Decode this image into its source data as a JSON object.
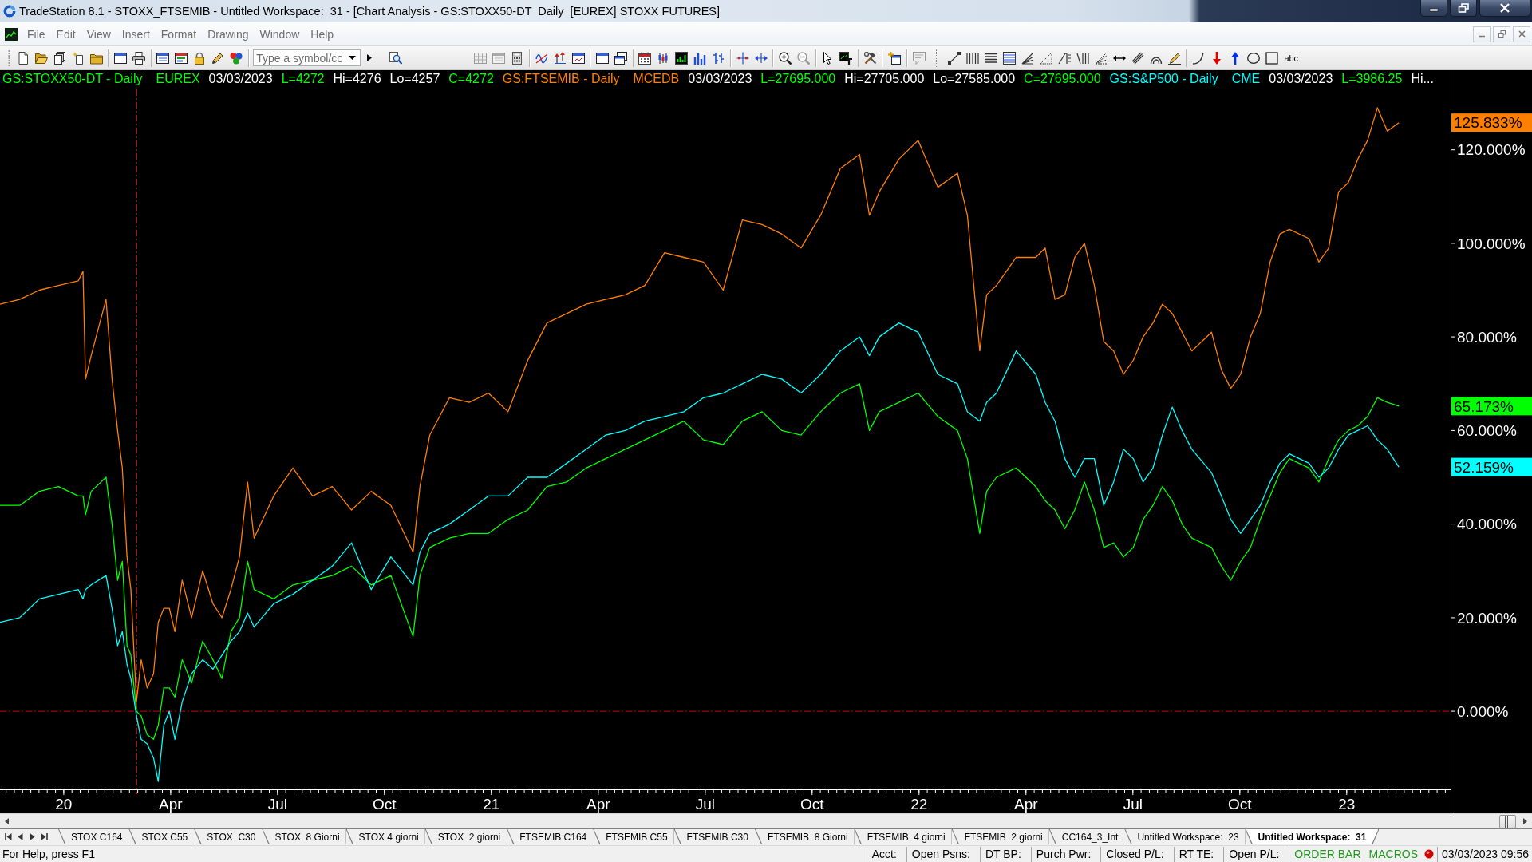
{
  "window": {
    "title": "TradeStation 8.1 - STOXX_FTSEMIB - Untitled Workspace:  31 - [Chart Analysis - GS:STOXX50-DT  Daily  [EUREX] STOXX FUTURES]"
  },
  "menu": [
    "File",
    "Edit",
    "View",
    "Insert",
    "Format",
    "Drawing",
    "Window",
    "Help"
  ],
  "toolbar": {
    "symbol_field": {
      "placeholder": "Type a symbol/co"
    },
    "text_tool": "abc"
  },
  "chart": {
    "legend": [
      {
        "symbol": "GS:STOXX50-DT - Daily",
        "exchange": "EUREX",
        "date": "03/03/2023",
        "last": "L=4272",
        "high": "Hi=4276",
        "low": "Lo=4257",
        "close": "C=4272",
        "color": "#00ff00"
      },
      {
        "symbol": "GS:FTSEMIB - Daily",
        "exchange": "MCEDB",
        "date": "03/03/2023",
        "last": "L=27695.000",
        "high": "Hi=27705.000",
        "low": "Lo=27585.000",
        "close": "C=27695.000",
        "color": "#ff8000"
      },
      {
        "symbol": "GS:S&P500 - Daily",
        "exchange": "CME",
        "date": "03/03/2023",
        "last": "L=3986.25",
        "high": "Hi...",
        "color": "#00ffff"
      }
    ],
    "last_value_labels": [
      "125.833%",
      "65.173%",
      "52.159%"
    ],
    "chart_data": {
      "type": "line",
      "x": [
        2019.851,
        2019.897,
        2019.943,
        2019.988,
        2020.034,
        2020.045,
        2020.051,
        2020.064,
        2020.099,
        2020.113,
        2020.126,
        2020.137,
        2020.148,
        2020.157,
        2020.17,
        2020.181,
        2020.195,
        2020.21,
        2020.221,
        2020.234,
        2020.247,
        2020.26,
        2020.277,
        2020.299,
        2020.325,
        2020.349,
        2020.37,
        2020.391,
        2020.411,
        2020.43,
        2020.445,
        2020.491,
        2020.536,
        2020.582,
        2020.628,
        2020.673,
        2020.719,
        2020.765,
        2020.817,
        2020.833,
        2020.856,
        2020.902,
        2020.948,
        2020.993,
        2021.039,
        2021.085,
        2021.13,
        2021.176,
        2021.222,
        2021.267,
        2021.313,
        2021.359,
        2021.405,
        2021.45,
        2021.496,
        2021.542,
        2021.587,
        2021.633,
        2021.679,
        2021.724,
        2021.77,
        2021.816,
        2021.861,
        2021.884,
        2021.907,
        2021.953,
        2021.998,
        2022.044,
        2022.09,
        2022.113,
        2022.142,
        2022.158,
        2022.181,
        2022.227,
        2022.273,
        2022.295,
        2022.318,
        2022.341,
        2022.364,
        2022.387,
        2022.41,
        2022.432,
        2022.455,
        2022.478,
        2022.501,
        2022.524,
        2022.547,
        2022.569,
        2022.592,
        2022.615,
        2022.638,
        2022.684,
        2022.707,
        2022.729,
        2022.752,
        2022.775,
        2022.798,
        2022.821,
        2022.844,
        2022.866,
        2022.912,
        2022.935,
        2022.958,
        2022.981,
        2023.004,
        2023.026,
        2023.049,
        2023.072,
        2023.095,
        2023.122
      ],
      "series": [
        {
          "color": "#ff8000",
          "values": [
            87,
            88,
            90,
            91,
            92,
            94,
            71,
            76,
            88,
            71,
            60,
            52,
            33,
            26,
            2,
            11,
            5,
            8,
            19,
            22,
            22,
            17,
            28,
            20,
            30,
            23,
            20,
            26,
            33,
            49,
            37,
            46,
            52,
            46,
            48,
            43,
            47,
            44,
            34,
            48,
            59,
            67,
            66,
            68,
            64,
            75,
            83,
            85,
            87,
            88,
            89,
            91,
            98,
            97,
            96,
            90,
            105,
            104,
            102,
            99,
            106,
            116,
            119,
            106,
            111,
            118,
            122,
            112,
            115,
            106,
            77,
            89,
            91,
            97,
            97,
            99,
            88,
            89,
            97,
            100,
            91,
            79,
            77,
            72,
            75,
            80,
            83,
            87,
            85,
            81,
            77,
            81,
            73,
            69,
            72,
            80,
            85,
            96,
            102,
            103,
            101,
            96,
            99,
            111,
            113,
            118,
            122,
            129,
            124,
            125.8
          ]
        },
        {
          "color": "#00ff00",
          "values": [
            44,
            44,
            47,
            48,
            46,
            46,
            42,
            47,
            50,
            40,
            28,
            32,
            14,
            12,
            0,
            -1,
            -5,
            -6,
            -3,
            5,
            5,
            3,
            11,
            6,
            15,
            11,
            7,
            17,
            20,
            32,
            26,
            24,
            27,
            28,
            29,
            31,
            27,
            29,
            16,
            29,
            35,
            37,
            38,
            38,
            41,
            43,
            48,
            49,
            52,
            54,
            56,
            58,
            60,
            62,
            58,
            57,
            62,
            64,
            60,
            59,
            64,
            68,
            70,
            60,
            64,
            66,
            68,
            63,
            60,
            54,
            38,
            47,
            50,
            52,
            48,
            45,
            43,
            39,
            43,
            49,
            43,
            35,
            36,
            33,
            35,
            41,
            44,
            48,
            45,
            40,
            37,
            35,
            31,
            28,
            32,
            35,
            41,
            46,
            51,
            54,
            52,
            49,
            54,
            58,
            60,
            61,
            63,
            67,
            66,
            65.2
          ]
        },
        {
          "color": "#00ffff",
          "values": [
            19,
            20,
            24,
            25,
            26,
            24,
            26,
            27,
            29,
            22,
            14,
            17,
            10,
            7,
            -1,
            -6,
            -7,
            -10,
            -15,
            -3,
            0,
            -6,
            2,
            8,
            11,
            9,
            12,
            15,
            17,
            21,
            18,
            23,
            25,
            28,
            31,
            36,
            26,
            33,
            27,
            34,
            38,
            40,
            43,
            46,
            46,
            50,
            50,
            53,
            56,
            59,
            60,
            62,
            63,
            64,
            67,
            68,
            70,
            72,
            71,
            68,
            72,
            77,
            80,
            76,
            80,
            83,
            81,
            72,
            70,
            64,
            62,
            66,
            68,
            77,
            72,
            66,
            62,
            54,
            50,
            54,
            54,
            44,
            49,
            56,
            54,
            49,
            52,
            59,
            65,
            60,
            56,
            51,
            46,
            41,
            38,
            41,
            44,
            49,
            53,
            55,
            53,
            50,
            52,
            56,
            59,
            60,
            61,
            58,
            56,
            52.2
          ]
        }
      ],
      "xlim": [
        2019.851,
        2023.243
      ],
      "ylim": [
        -16.7,
        137.0
      ],
      "xticks": [
        {
          "value": 2020,
          "label": "20"
        },
        {
          "value": 2020.25,
          "label": "Apr"
        },
        {
          "value": 2020.5,
          "label": "Jul"
        },
        {
          "value": 2020.75,
          "label": "Oct"
        },
        {
          "value": 2021,
          "label": "21"
        },
        {
          "value": 2021.25,
          "label": "Apr"
        },
        {
          "value": 2021.5,
          "label": "Jul"
        },
        {
          "value": 2021.75,
          "label": "Oct"
        },
        {
          "value": 2022,
          "label": "22"
        },
        {
          "value": 2022.25,
          "label": "Apr"
        },
        {
          "value": 2022.5,
          "label": "Jul"
        },
        {
          "value": 2022.75,
          "label": "Oct"
        },
        {
          "value": 2023,
          "label": "23"
        }
      ],
      "yticks": [
        {
          "value": 0,
          "label": "0.000%"
        },
        {
          "value": 20,
          "label": "20.000%"
        },
        {
          "value": 40,
          "label": "40.000%"
        },
        {
          "value": 60,
          "label": "60.000%"
        },
        {
          "value": 80,
          "label": "80.000%"
        },
        {
          "value": 100,
          "label": "100.000%"
        },
        {
          "value": 120,
          "label": "120.000%"
        }
      ],
      "ref_lines": [
        {
          "axis": "y",
          "value": 0
        },
        {
          "axis": "x",
          "value": 2020.171
        }
      ]
    }
  },
  "sheet_tabs": [
    {
      "label": "STOX C164",
      "selected": false
    },
    {
      "label": "STOX C55",
      "selected": false
    },
    {
      "label": "STOX  C30",
      "selected": false
    },
    {
      "label": "STOX  8 Giorni",
      "selected": false
    },
    {
      "label": "STOX 4 giorni",
      "selected": false
    },
    {
      "label": "STOX  2 giorni",
      "selected": false
    },
    {
      "label": "FTSEMIB C164",
      "selected": false
    },
    {
      "label": "FTSEMIB C55",
      "selected": false
    },
    {
      "label": "FTSEMIB C30",
      "selected": false
    },
    {
      "label": "FTSEMIB  8 Giorni",
      "selected": false
    },
    {
      "label": "FTSEMIB  4 giorni",
      "selected": false
    },
    {
      "label": "FTSEMIB  2 giorni",
      "selected": false
    },
    {
      "label": "CC164_3_Int",
      "selected": false
    },
    {
      "label": "Untitled Workspace:  23",
      "selected": false
    },
    {
      "label": "Untitled Workspace:  31",
      "selected": true
    }
  ],
  "status_bar": {
    "help_text": "For Help, press F1",
    "fields": [
      "Acct:",
      "Open Psns:",
      "DT BP:",
      "Purch Pwr:",
      "Closed P/L:",
      "RT TE:",
      "Open P/L:"
    ],
    "order_bar": "ORDER BAR",
    "macros": "MACROS",
    "datetime": "03/03/2023 09:56"
  }
}
